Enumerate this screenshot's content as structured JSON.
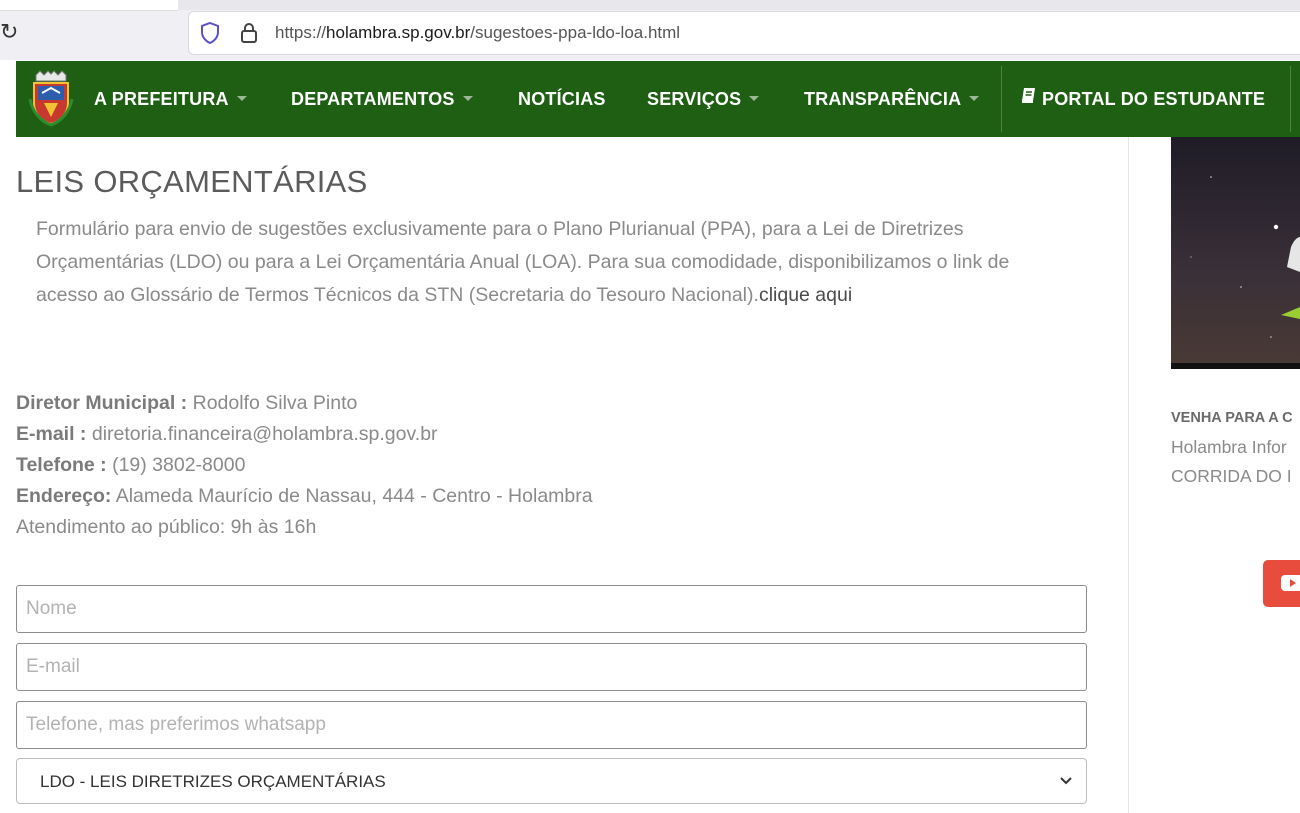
{
  "browser": {
    "url_scheme": "https://",
    "url_host": "holambra.sp.gov.br",
    "url_path": "/sugestoes-ppa-ldo-loa.html"
  },
  "navbar": {
    "items": [
      {
        "label": "A PREFEITURA",
        "dropdown": true
      },
      {
        "label": "DEPARTAMENTOS",
        "dropdown": true
      },
      {
        "label": "NOTÍCIAS",
        "dropdown": false
      },
      {
        "label": "SERVIÇOS",
        "dropdown": true
      },
      {
        "label": "TRANSPARÊNCIA",
        "dropdown": true
      }
    ],
    "portal_label": "PORTAL DO ESTUDANTE"
  },
  "main": {
    "title": "LEIS ORÇAMENTÁRIAS",
    "intro_text": "Formulário para envio de sugestões exclusivamente para o Plano Plurianual (PPA), para a Lei de Diretrizes Orçamentárias (LDO) ou para a Lei Orçamentária Anual (LOA). Para sua comodidade, disponibilizamos o link de acesso ao Glossário de Termos Técnicos da STN (Secretaria do Tesouro Nacional).",
    "intro_link": "clique aqui",
    "info": {
      "director_label": "Diretor Municipal :",
      "director_value": " Rodolfo Silva Pinto",
      "email_label": "E-mail :",
      "email_value": " diretoria.financeira@holambra.sp.gov.br",
      "phone_label": "Telefone :",
      "phone_value": " (19) 3802-8000",
      "address_label": "Endereço:",
      "address_value": " Alameda Maurício de Nassau, 444 - Centro - Holambra",
      "hours": "Atendimento ao público: 9h às 16h"
    },
    "form": {
      "name_placeholder": "Nome",
      "email_placeholder": "E-mail",
      "phone_placeholder": "Telefone, mas preferimos whatsapp",
      "select_value": "LDO - LEIS DIRETRIZES ORÇAMENTÁRIAS"
    }
  },
  "sidebar": {
    "heading": "VENHA PARA A C",
    "line1": "Holambra Infor",
    "line2": "CORRIDA DO I"
  },
  "colors": {
    "navbar": "#1e5f13",
    "youtube": "#e74c3c"
  }
}
